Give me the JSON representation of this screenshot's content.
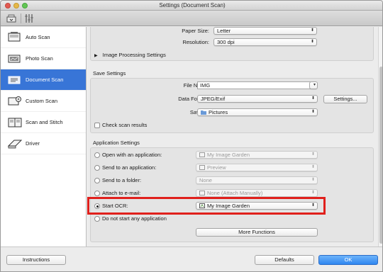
{
  "window": {
    "title": "Settings (Document Scan)"
  },
  "sidebar": {
    "items": [
      {
        "label": "Auto Scan",
        "icon": "auto-scan-icon"
      },
      {
        "label": "Photo Scan",
        "icon": "photo-scan-icon"
      },
      {
        "label": "Document Scan",
        "icon": "document-scan-icon",
        "active": true
      },
      {
        "label": "Custom Scan",
        "icon": "custom-scan-icon"
      },
      {
        "label": "Scan and Stitch",
        "icon": "scan-stitch-icon"
      },
      {
        "label": "Driver",
        "icon": "driver-icon"
      }
    ]
  },
  "scan_options": {
    "paper_size_label": "Paper Size:",
    "paper_size_value": "Letter",
    "resolution_label": "Resolution:",
    "resolution_value": "300 dpi",
    "image_processing_label": "Image Processing Settings"
  },
  "save_settings": {
    "title": "Save Settings",
    "file_name_label": "File Name:",
    "file_name_value": "IMG",
    "data_format_label": "Data Format:",
    "data_format_value": "JPEG/Exif",
    "settings_button": "Settings...",
    "save_in_label": "Save in:",
    "save_in_value": "Pictures",
    "check_results_label": "Check scan results"
  },
  "application_settings": {
    "title": "Application Settings",
    "options": [
      {
        "label": "Open with an application:",
        "value": "My Image Garden",
        "selected": false
      },
      {
        "label": "Send to an application:",
        "value": "Preview",
        "selected": false
      },
      {
        "label": "Send to a folder:",
        "value": "None",
        "selected": false
      },
      {
        "label": "Attach to e-mail:",
        "value": "None (Attach Manually)",
        "selected": false
      },
      {
        "label": "Start OCR:",
        "value": "My Image Garden",
        "selected": true
      },
      {
        "label": "Do not start any application",
        "value": "",
        "selected": false
      }
    ],
    "more_functions_button": "More Functions"
  },
  "footer": {
    "instructions_button": "Instructions",
    "defaults_button": "Defaults",
    "ok_button": "OK"
  },
  "colors": {
    "accent": "#3875d7",
    "highlight": "#e0201c"
  }
}
